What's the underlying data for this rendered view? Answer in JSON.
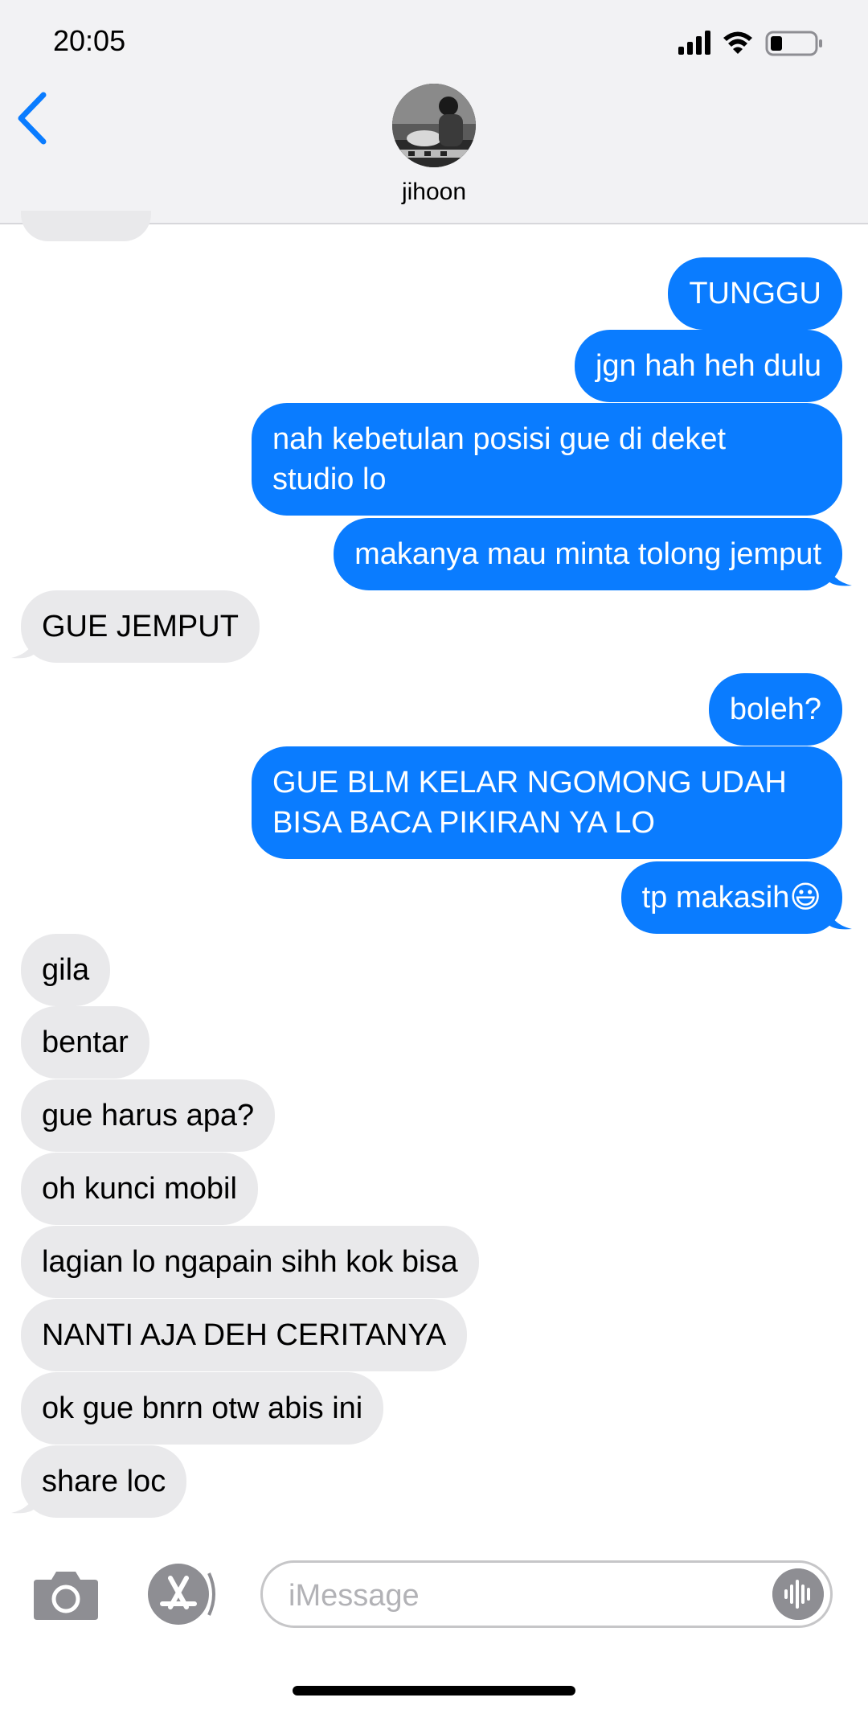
{
  "status_bar": {
    "time": "20:05"
  },
  "header": {
    "contact_name": "jihoon"
  },
  "messages": [
    {
      "from": "me",
      "text": "TUNGGU"
    },
    {
      "from": "me",
      "text": "jgn hah heh dulu"
    },
    {
      "from": "me",
      "line1": "nah kebetulan posisi gue di deket",
      "line2": "studio lo"
    },
    {
      "from": "me",
      "text": "makanya mau minta tolong jemput"
    },
    {
      "from": "them",
      "text": "GUE JEMPUT"
    },
    {
      "from": "me",
      "text": "boleh?"
    },
    {
      "from": "me",
      "line1": "GUE BLM KELAR NGOMONG UDAH",
      "line2": "BISA BACA PIKIRAN YA LO"
    },
    {
      "from": "me",
      "text": "tp makasih",
      "emoji": "😃"
    },
    {
      "from": "them",
      "text": "gila"
    },
    {
      "from": "them",
      "text": "bentar"
    },
    {
      "from": "them",
      "text": "gue harus apa?"
    },
    {
      "from": "them",
      "text": "oh kunci mobil"
    },
    {
      "from": "them",
      "text": "lagian lo ngapain sihh kok bisa"
    },
    {
      "from": "them",
      "text": "NANTI AJA DEH CERITANYA"
    },
    {
      "from": "them",
      "text": "ok gue bnrn otw abis ini"
    },
    {
      "from": "them",
      "text": "share loc"
    }
  ],
  "composer": {
    "placeholder": "iMessage"
  },
  "colors": {
    "sent": "#0a7cff",
    "received": "#e9e9eb",
    "accent": "#0a7cff"
  },
  "icons": [
    "back-chevron-icon",
    "signal-icon",
    "wifi-icon",
    "battery-icon",
    "camera-icon",
    "app-store-icon",
    "audio-waveform-icon"
  ]
}
